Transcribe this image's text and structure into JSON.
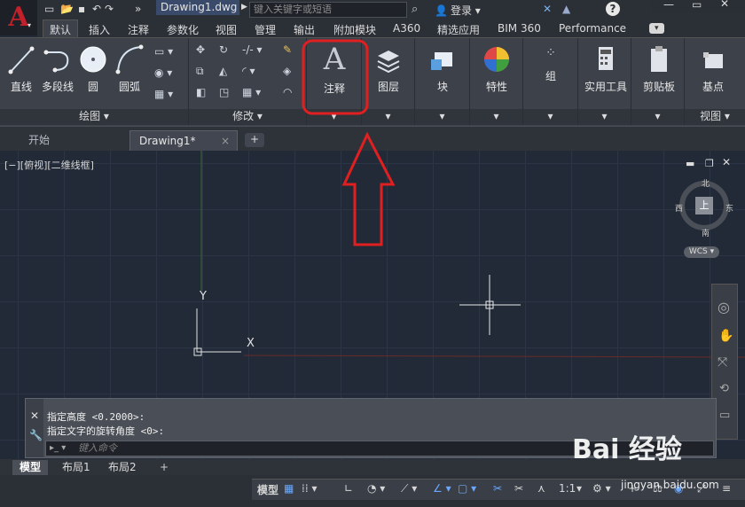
{
  "title_bar": {
    "doc_title": "Drawing1.dwg",
    "search_placeholder": "键入关键字或短语",
    "login_label": "登录"
  },
  "ribbon_tabs": [
    "默认",
    "插入",
    "注释",
    "参数化",
    "视图",
    "管理",
    "输出",
    "附加模块",
    "A360",
    "精选应用",
    "BIM 360",
    "Performance"
  ],
  "draw_panel": {
    "tools": [
      "直线",
      "多段线",
      "圆",
      "圆弧"
    ],
    "footer": "绘图 ▾"
  },
  "modify_panel": {
    "footer": "修改 ▾"
  },
  "big_tools": [
    "注释",
    "图层",
    "块",
    "特性",
    "组",
    "实用工具",
    "剪贴板",
    "基点"
  ],
  "view_panel": {
    "footer": "视图 ▾"
  },
  "file_tabs": {
    "start": "开始",
    "active": "Drawing1*",
    "close_symbol": "×",
    "new_tab": "+"
  },
  "viewport_label": "[−][俯视][二维线框]",
  "compass": {
    "north": "北",
    "south": "南",
    "west": "西",
    "east": "东",
    "center": "上"
  },
  "wcs_label": "WCS ▾",
  "ucs": {
    "x": "X",
    "y": "Y"
  },
  "command": {
    "lines": [
      "指定高度 <0.2000>:",
      "指定文字的旋转角度 <0>:"
    ],
    "placeholder": "键入命令"
  },
  "layout_tabs": [
    "模型",
    "布局1",
    "布局2"
  ],
  "status": {
    "model": "模型",
    "scale": "1:1"
  },
  "watermark": {
    "brand": "Bai 经验",
    "url": "jingyan.baidu.com"
  },
  "colors": {
    "annotation": "#e02020",
    "background": "#222a37",
    "ribbon": "#3c414a"
  }
}
